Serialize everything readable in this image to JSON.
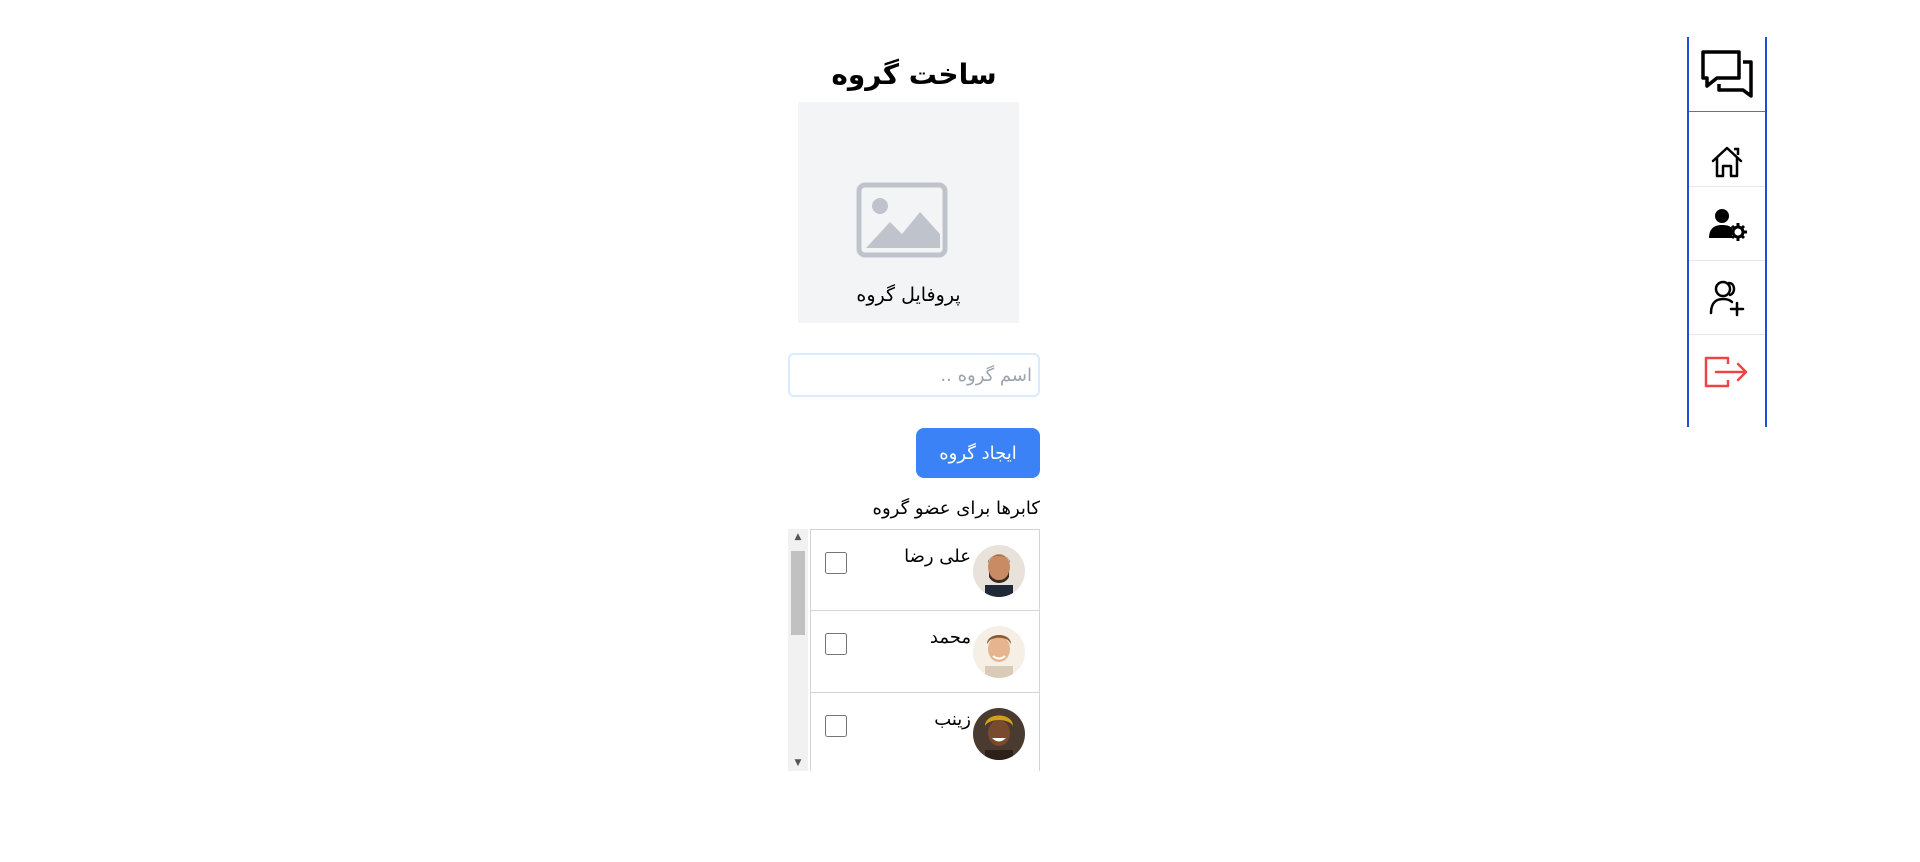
{
  "sidebar": {
    "logo_icon": "chat-bubbles-icon",
    "items": [
      {
        "icon": "home-icon",
        "name": "home"
      },
      {
        "icon": "user-settings-icon",
        "name": "user-settings"
      },
      {
        "icon": "add-user-icon",
        "name": "add-user"
      },
      {
        "icon": "logout-icon",
        "name": "logout",
        "color": "#ef4444"
      }
    ],
    "accent_color": "#1d4ed8"
  },
  "form": {
    "title": "ساخت گروه",
    "profile_label": "پروفایل گروه",
    "profile_icon": "image-placeholder-icon",
    "name_placeholder": "اسم گروه ..",
    "name_value": "",
    "create_button": "ایجاد گروه",
    "button_color": "#3b82f6",
    "users_label": "کابرها برای عضو گروه"
  },
  "users": [
    {
      "name": "علی رضا",
      "checked": false
    },
    {
      "name": "محمد",
      "checked": false
    },
    {
      "name": "زینب",
      "checked": false
    }
  ]
}
